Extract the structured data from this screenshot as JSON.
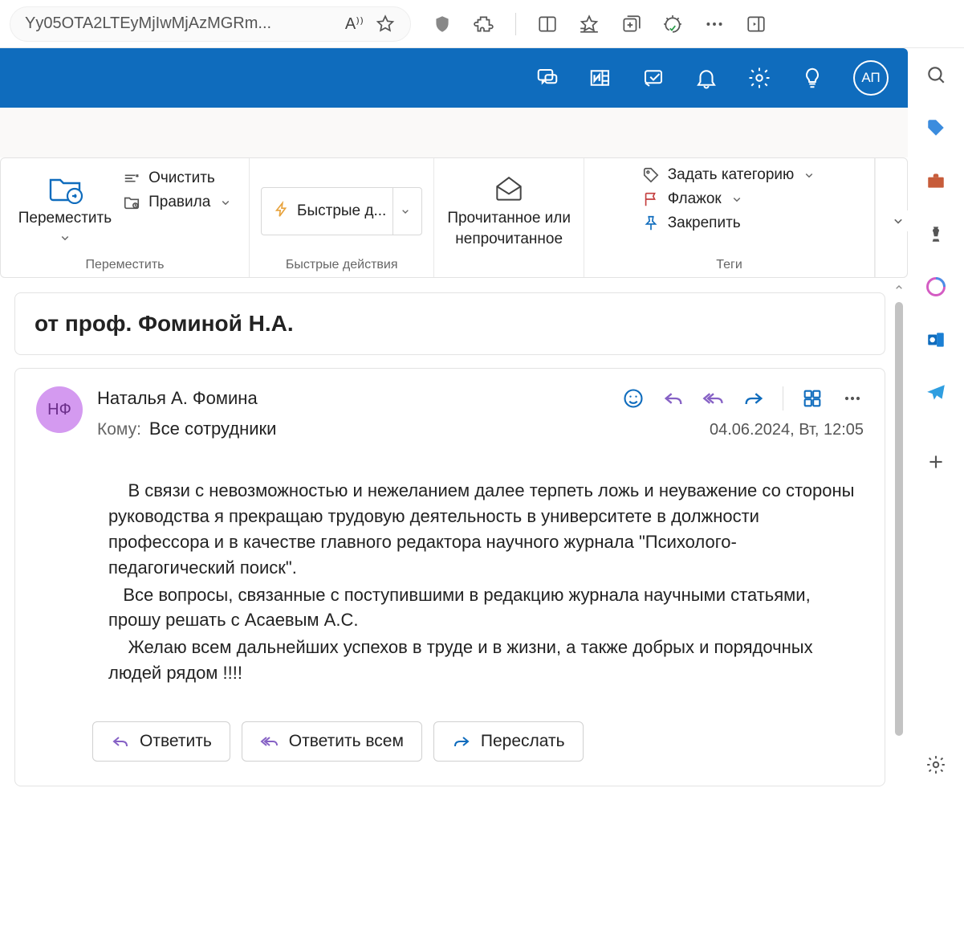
{
  "browser": {
    "url_fragment": "Yy05OTA2LTEyMjIwMjAzMGRm...",
    "read_aloud_label": "A⁾⁾"
  },
  "app_header": {
    "avatar_initials": "АП"
  },
  "ribbon": {
    "move": {
      "button": "Переместить",
      "clear": "Очистить",
      "rules": "Правила",
      "group_label": "Переместить"
    },
    "quick": {
      "button": "Быстрые д...",
      "group_label": "Быстрые действия"
    },
    "read": {
      "button_line1": "Прочитанное или",
      "button_line2": "непрочитанное"
    },
    "tags": {
      "category": "Задать категорию",
      "flag": "Флажок",
      "pin": "Закрепить",
      "group_label": "Теги"
    }
  },
  "message": {
    "subject": "от проф. Фоминой Н.А.",
    "sender_name": "Наталья А. Фомина",
    "sender_initials": "НФ",
    "to_label": "Кому:",
    "to_value": "Все сотрудники",
    "date": "04.06.2024, Вт, 12:05",
    "body_p1": "    В связи с невозможностью и нежеланием далее терпеть ложь и неуважение со стороны руководства я прекращаю трудовую деятельность в университете в должности профессора и в качестве главного редактора научного журнала \"Психолого-педагогический поиск\".",
    "body_p2": "   Все вопросы, связанные с поступившими в редакцию журнала научными статьями, прошу решать с Асаевым А.С.",
    "body_p3": "    Желаю всем дальнейших успехов в труде и в жизни, а также добрых и порядочных людей рядом !!!!",
    "reply": "Ответить",
    "reply_all": "Ответить всем",
    "forward": "Переслать"
  }
}
